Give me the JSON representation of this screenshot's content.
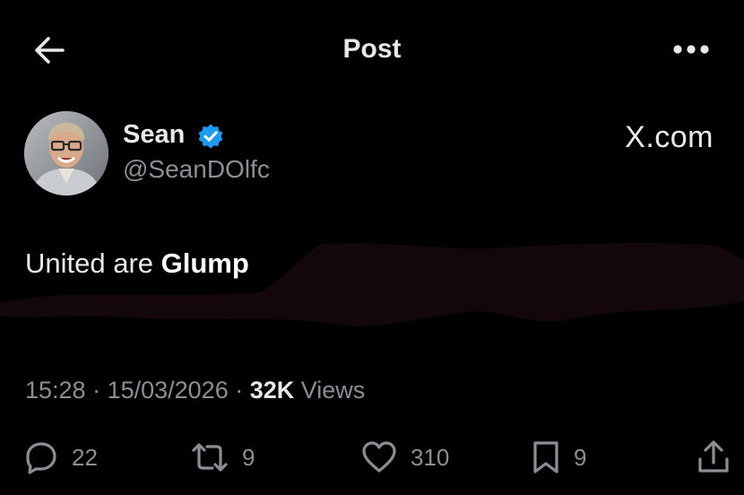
{
  "header": {
    "title": "Post",
    "back_icon": "arrow-left-icon",
    "more_icon": "more-dots-icon"
  },
  "author": {
    "name": "Sean",
    "handle": "@SeanDOlfc",
    "verified": true,
    "verified_color": "#1d9bf0"
  },
  "watermark": "X.com",
  "tweet": {
    "text_plain": "United are ",
    "text_bold": "Glump"
  },
  "meta": {
    "time": "15:28",
    "sep1": " · ",
    "date": "15/03/2026",
    "sep2": " · ",
    "views_count": "32K",
    "views_label": " Views"
  },
  "actions": {
    "replies": {
      "icon": "reply-icon",
      "count": "22"
    },
    "reposts": {
      "icon": "repost-icon",
      "count": "9"
    },
    "likes": {
      "icon": "heart-icon",
      "count": "310"
    },
    "bookmarks": {
      "icon": "bookmark-icon",
      "count": "9"
    },
    "share": {
      "icon": "share-icon"
    }
  },
  "colors": {
    "background": "#000000",
    "text": "#e7e9ea",
    "secondary": "#8b8f94",
    "accent": "#1d9bf0"
  }
}
